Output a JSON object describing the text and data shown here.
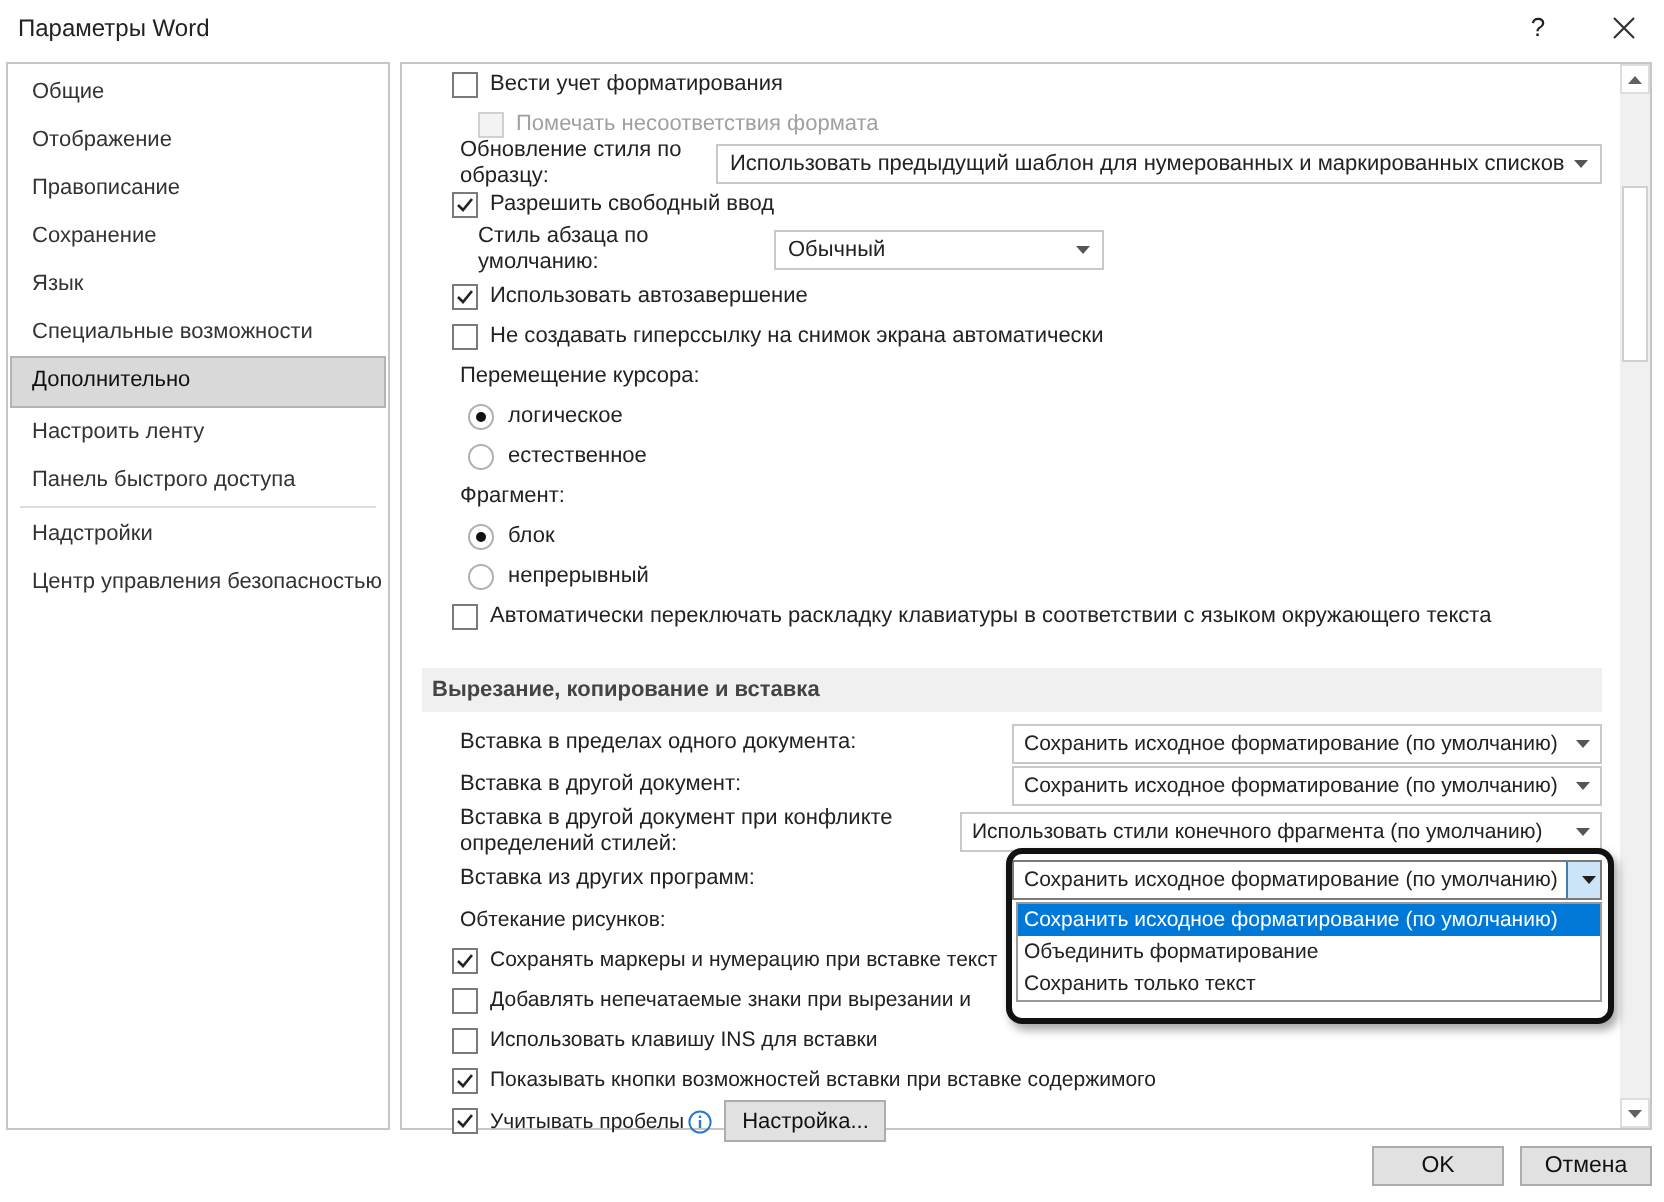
{
  "window": {
    "title": "Параметры Word",
    "help": "?"
  },
  "sidebar": {
    "groups": [
      [
        {
          "label": "Общие",
          "selected": false
        },
        {
          "label": "Отображение",
          "selected": false
        },
        {
          "label": "Правописание",
          "selected": false
        },
        {
          "label": "Сохранение",
          "selected": false
        },
        {
          "label": "Язык",
          "selected": false
        },
        {
          "label": "Специальные возможности",
          "selected": false
        },
        {
          "label": "Дополнительно",
          "selected": true
        },
        {
          "label": "Настроить ленту",
          "selected": false
        },
        {
          "label": "Панель быстрого доступа",
          "selected": false
        }
      ],
      [
        {
          "label": "Надстройки",
          "selected": false
        },
        {
          "label": "Центр управления безопасностью",
          "selected": false
        }
      ]
    ]
  },
  "options": [
    {
      "kind": "checkbox",
      "label": "Вести учет форматирования",
      "checked": false,
      "children": [
        {
          "kind": "checkbox",
          "label": "Помечать несоответствия формата",
          "checked": false,
          "disabled": true
        }
      ]
    },
    {
      "kind": "combo",
      "label": "Обновление стиля по образцу:",
      "value": "Использовать предыдущий шаблон для нумерованных и маркированных списков",
      "expanded": false
    },
    {
      "kind": "checkbox",
      "label": "Разрешить свободный ввод",
      "checked": true,
      "children": [
        {
          "kind": "combo",
          "label": "Стиль абзаца по умолчанию:",
          "value": "Обычный",
          "expanded": false
        }
      ]
    },
    {
      "kind": "checkbox",
      "label": "Использовать автозавершение",
      "checked": true
    },
    {
      "kind": "checkbox",
      "label": "Не создавать гиперссылку на снимок экрана автоматически",
      "checked": false
    },
    {
      "kind": "group",
      "label": "Перемещение курсора:",
      "children": [
        {
          "kind": "radio",
          "label": "логическое",
          "selected": true
        },
        {
          "kind": "radio",
          "label": "естественное",
          "selected": false
        }
      ]
    },
    {
      "kind": "group",
      "label": "Фрагмент:",
      "children": [
        {
          "kind": "radio",
          "label": "блок",
          "selected": true
        },
        {
          "kind": "radio",
          "label": "непрерывный",
          "selected": false
        }
      ]
    },
    {
      "kind": "checkbox",
      "label": "Автоматически переключать раскладку клавиатуры в соответствии с языком окружающего текста",
      "checked": false
    },
    {
      "kind": "section",
      "label": "Вырезание, копирование и вставка",
      "children": [
        {
          "kind": "combo",
          "label": "Вставка в пределах одного документа:",
          "value": "Сохранить исходное форматирование (по умолчанию)",
          "expanded": false
        },
        {
          "kind": "combo",
          "label": "Вставка в другой документ:",
          "value": "Сохранить исходное форматирование (по умолчанию)",
          "expanded": false
        },
        {
          "kind": "combo",
          "label": "Вставка в другой документ при конфликте определений стилей:",
          "value": "Использовать стили конечного фрагмента (по умолчанию)",
          "expanded": false
        },
        {
          "kind": "combo",
          "label": "Вставка из других программ:",
          "value": "Сохранить исходное форматирование (по умолчанию)",
          "expanded": true,
          "options": [
            {
              "label": "Сохранить исходное форматирование (по умолчанию)",
              "selected": true
            },
            {
              "label": "Объединить форматирование",
              "selected": false
            },
            {
              "label": "Сохранить только текст",
              "selected": false
            }
          ]
        },
        {
          "kind": "label",
          "label": "Обтекание рисунков:"
        },
        {
          "kind": "checkbox",
          "label": "Сохранять маркеры и нумерацию при вставке текст",
          "checked": true
        },
        {
          "kind": "checkbox",
          "label": "Добавлять непечатаемые знаки при вырезании и",
          "checked": false
        },
        {
          "kind": "checkbox",
          "label": "Использовать клавишу INS для вставки",
          "checked": false
        },
        {
          "kind": "checkbox",
          "label": "Показывать кнопки возможностей вставки при вставке содержимого",
          "checked": true
        },
        {
          "kind": "checkbox",
          "label": "Учитывать пробелы",
          "checked": true,
          "info": true,
          "button": "Настройка..."
        }
      ]
    }
  ],
  "buttons": [
    "OK",
    "Отмена"
  ]
}
